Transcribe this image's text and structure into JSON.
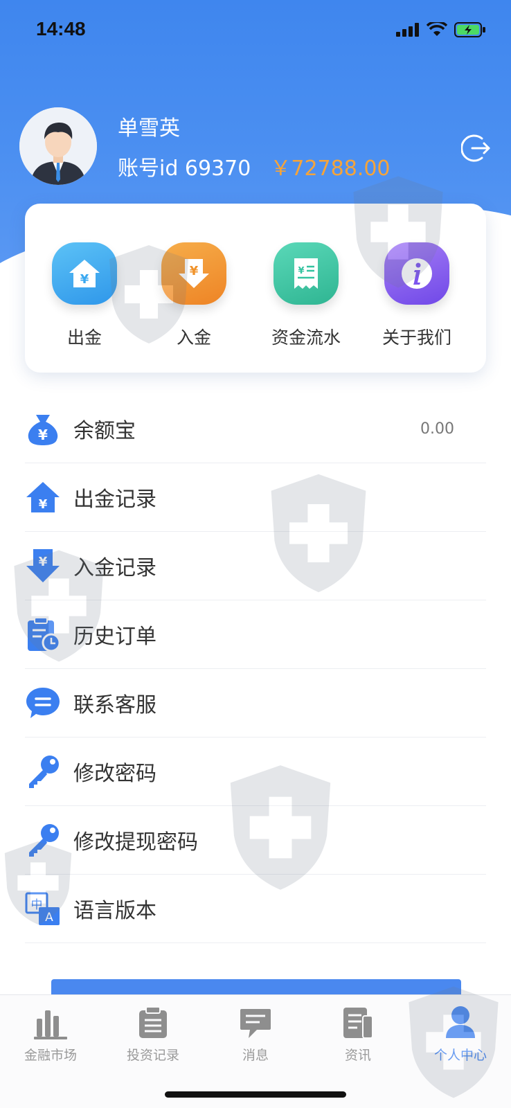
{
  "status_bar": {
    "time": "14:48"
  },
  "profile": {
    "name": "单雪英",
    "account_id": "账号id 69370",
    "balance": "￥72788.00"
  },
  "quick_actions": [
    {
      "label": "出金",
      "icon": "withdraw-house-icon",
      "color": "#3aa8f0"
    },
    {
      "label": "入金",
      "icon": "deposit-arrow-icon",
      "color": "#f0932b"
    },
    {
      "label": "资金流水",
      "icon": "receipt-icon",
      "color": "#34c3a0"
    },
    {
      "label": "关于我们",
      "icon": "info-icon",
      "color": "#8a5ef0"
    }
  ],
  "menu": [
    {
      "label": "余额宝",
      "icon": "money-bag-icon",
      "value": "0.00"
    },
    {
      "label": "出金记录",
      "icon": "withdraw-record-icon"
    },
    {
      "label": "入金记录",
      "icon": "deposit-record-icon"
    },
    {
      "label": "历史订单",
      "icon": "order-history-icon"
    },
    {
      "label": "联系客服",
      "icon": "chat-bubble-icon"
    },
    {
      "label": "修改密码",
      "icon": "key-icon"
    },
    {
      "label": "修改提现密码",
      "icon": "key-icon"
    },
    {
      "label": "语言版本",
      "icon": "language-icon"
    }
  ],
  "tabbar": [
    {
      "label": "金融市场",
      "icon": "bar-chart-icon"
    },
    {
      "label": "投资记录",
      "icon": "clipboard-icon"
    },
    {
      "label": "消息",
      "icon": "message-icon"
    },
    {
      "label": "资讯",
      "icon": "news-icon"
    },
    {
      "label": "个人中心",
      "icon": "user-icon",
      "active": true
    }
  ],
  "colors": {
    "primary": "#4a88ef",
    "balance": "#f5a43a"
  }
}
